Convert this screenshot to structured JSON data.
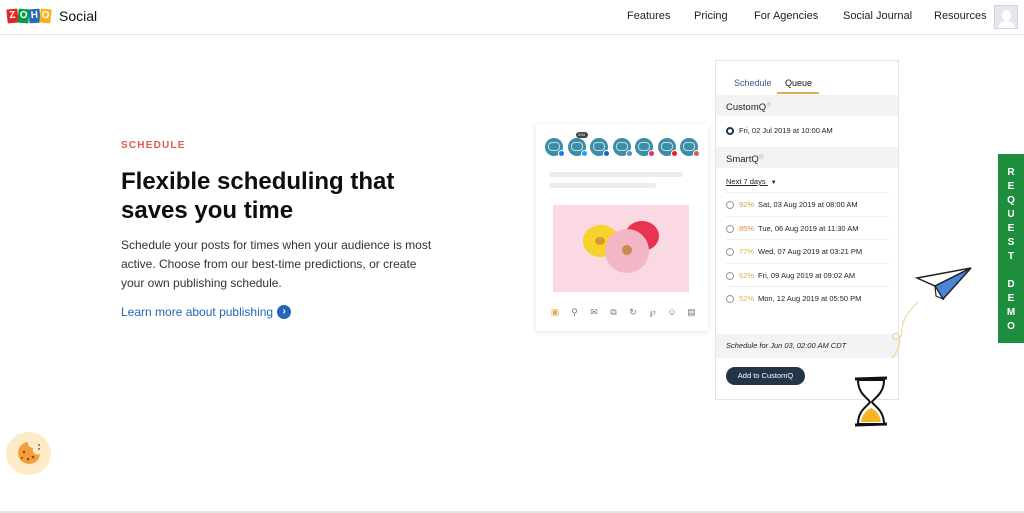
{
  "header": {
    "logo_letters": [
      "Z",
      "O",
      "H",
      "O"
    ],
    "brand": "Social",
    "nav": [
      "Features",
      "Pricing",
      "For Agencies",
      "Social Journal",
      "Resources"
    ]
  },
  "hero": {
    "eyebrow": "SCHEDULE",
    "title": "Flexible scheduling that saves you time",
    "description": "Schedule your posts for times when your audience is most active. Choose from our best-time predictions, or create your own publishing schedule.",
    "link": "Learn more about publishing",
    "link_icon": "chevron-right-circle-icon"
  },
  "composer": {
    "profile_badge": "234",
    "profiles": [
      {
        "network": "facebook",
        "color": "#1877f2"
      },
      {
        "network": "twitter",
        "color": "#1da1f2"
      },
      {
        "network": "linkedin",
        "color": "#0a66c2"
      },
      {
        "network": "google-business",
        "color": "#4a8fd6"
      },
      {
        "network": "instagram",
        "color": "#e1306c"
      },
      {
        "network": "youtube",
        "color": "#e62117"
      },
      {
        "network": "pinterest",
        "color": "#e0574f"
      }
    ],
    "tools": [
      {
        "name": "image-icon",
        "glyph": "▣"
      },
      {
        "name": "location-icon",
        "glyph": "⚲"
      },
      {
        "name": "mail-icon",
        "glyph": "✉"
      },
      {
        "name": "gif-icon",
        "glyph": "⧉"
      },
      {
        "name": "refresh-icon",
        "glyph": "↻"
      },
      {
        "name": "pinterest-icon",
        "glyph": "℘"
      },
      {
        "name": "emoji-icon",
        "glyph": "☺"
      },
      {
        "name": "article-icon",
        "glyph": "▤"
      }
    ]
  },
  "queue": {
    "tabs": [
      "Schedule",
      "Queue"
    ],
    "active_tab": "Queue",
    "customq_label": "CustomQ",
    "customq_slot": "Fri, 02 Jul 2019 at 10:00 AM",
    "smartq_label": "SmartQ",
    "range": "Next 7 days",
    "slots": [
      {
        "pct": "92%",
        "date": "Sat, 03 Aug 2019 at 08:00 AM",
        "color": "#d99a2b"
      },
      {
        "pct": "85%",
        "date": "Tue, 06 Aug 2019 at 11:30 AM",
        "color": "#e08a3c"
      },
      {
        "pct": "77%",
        "date": "Wed, 07 Aug 2019 at 03:21 PM",
        "color": "#c9b23a"
      },
      {
        "pct": "62%",
        "date": "Fri, 09 Aug 2019 at 09:02 AM",
        "color": "#e0a74a"
      },
      {
        "pct": "52%",
        "date": "Mon, 12 Aug 2019 at 05:50 PM",
        "color": "#e0b04a"
      }
    ],
    "schedule_for": "Schedule for Jun 03, 02:00 AM  CDT",
    "add_button": "Add to CustomQ"
  },
  "request_demo": "REQUEST  DEMO",
  "colors": {
    "accent_red": "#e05a4d",
    "link_blue": "#2467b8",
    "queue_tab_underline": "#e8a85a",
    "demo_green": "#1f8d3e",
    "button_navy": "#243548"
  }
}
